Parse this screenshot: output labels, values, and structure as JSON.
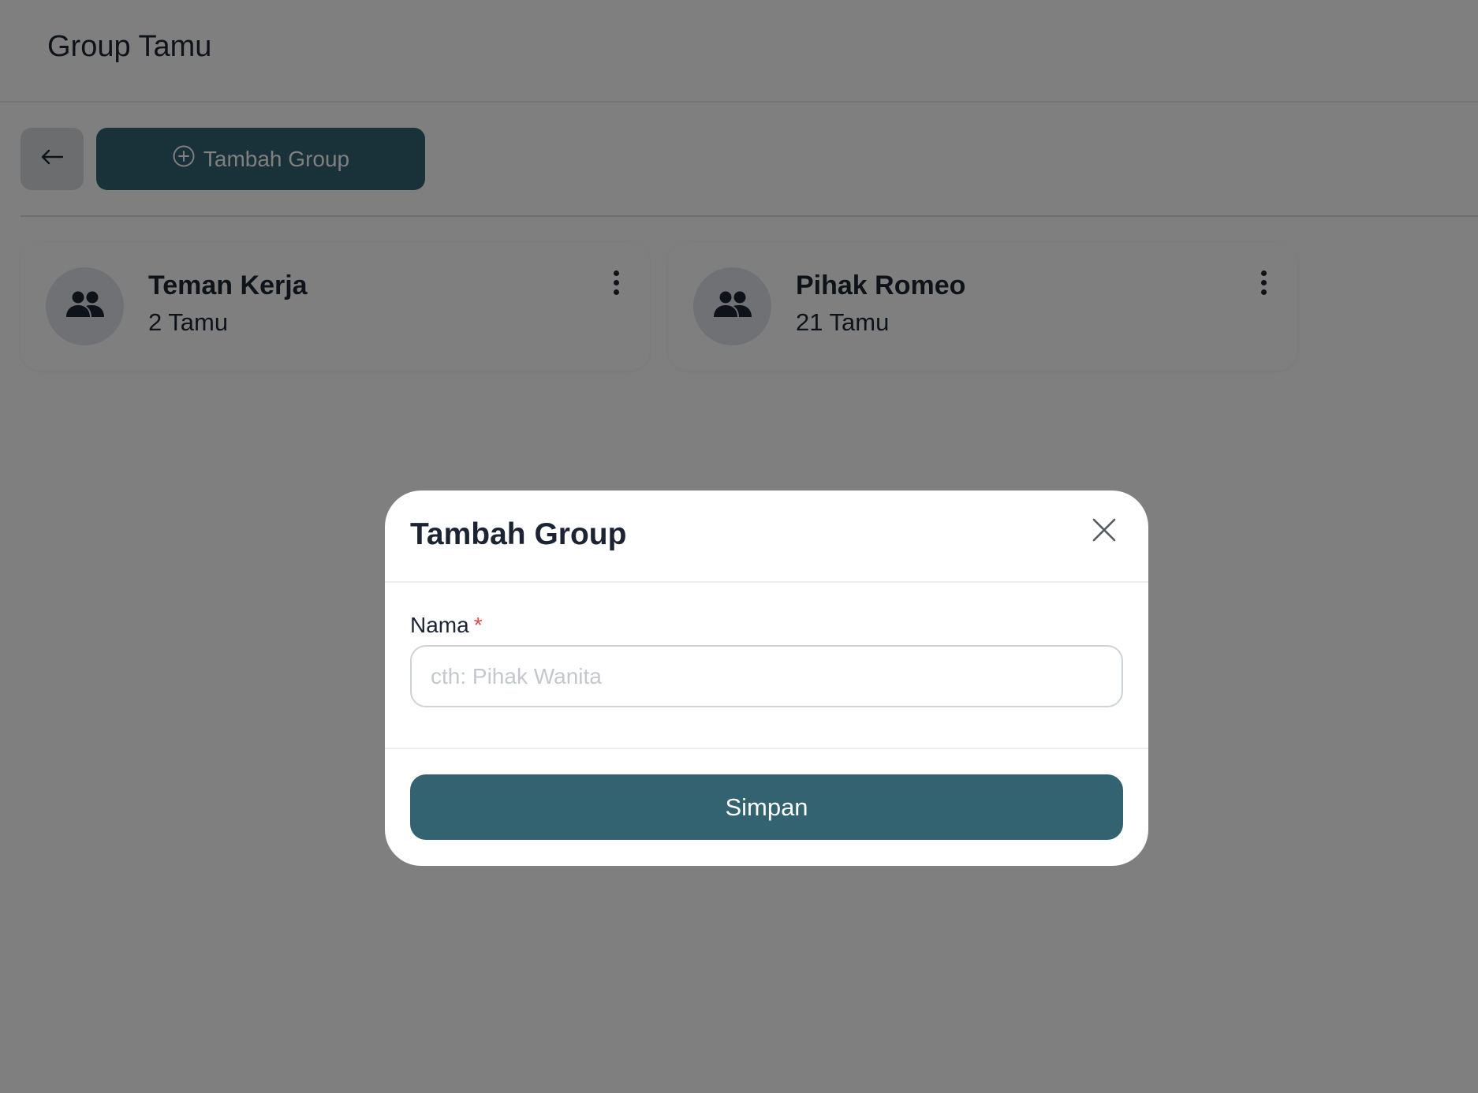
{
  "header": {
    "title": "Group Tamu"
  },
  "toolbar": {
    "back_icon": "arrow-left-icon",
    "add_group_label": "Tambah Group",
    "add_group_icon": "plus-circle-icon"
  },
  "groups": [
    {
      "name": "Teman Kerja",
      "count": "2 Tamu",
      "icon": "users-icon"
    },
    {
      "name": "Pihak Romeo",
      "count": "21 Tamu",
      "icon": "users-icon"
    }
  ],
  "modal": {
    "title": "Tambah Group",
    "close_icon": "close-icon",
    "field_label": "Nama",
    "required_marker": "*",
    "input_value": "",
    "input_placeholder": "cth: Pihak Wanita",
    "save_label": "Simpan"
  },
  "colors": {
    "primary": "#336370",
    "overlay": "rgba(0,0,0,0.5)",
    "required": "#e24a4a"
  }
}
